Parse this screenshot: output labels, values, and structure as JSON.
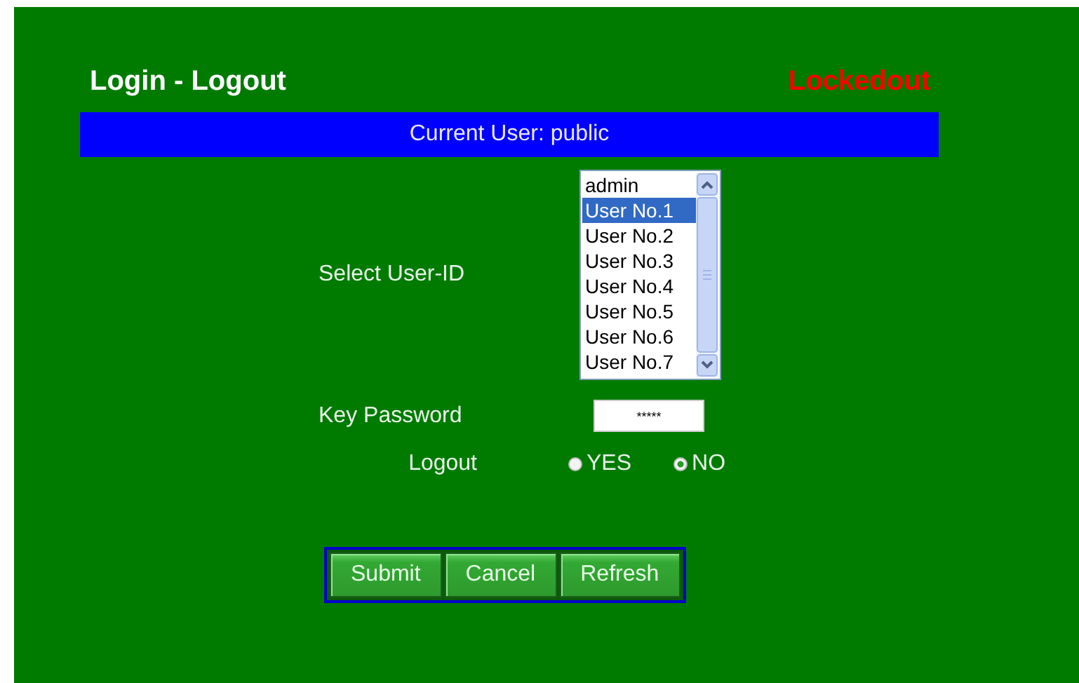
{
  "title": "Login - Logout",
  "status": "Lockedout",
  "current_user": "Current User: public",
  "fields": [
    {
      "kind": "list",
      "label": "Select User-ID",
      "options": [
        {
          "label": "admin",
          "selected": false
        },
        {
          "label": "User No.1",
          "selected": true
        },
        {
          "label": "User No.2",
          "selected": false
        },
        {
          "label": "User No.3",
          "selected": false
        },
        {
          "label": "User No.4",
          "selected": false
        },
        {
          "label": "User No.5",
          "selected": false
        },
        {
          "label": "User No.6",
          "selected": false
        },
        {
          "label": "User No.7",
          "selected": false
        }
      ]
    },
    {
      "kind": "password",
      "label": "Key Password",
      "value": "*****"
    },
    {
      "kind": "radio",
      "label": "Logout",
      "options": [
        {
          "label": "YES",
          "selected": false
        },
        {
          "label": "NO",
          "selected": true
        }
      ]
    }
  ],
  "buttons": [
    "Submit",
    "Cancel",
    "Refresh"
  ]
}
